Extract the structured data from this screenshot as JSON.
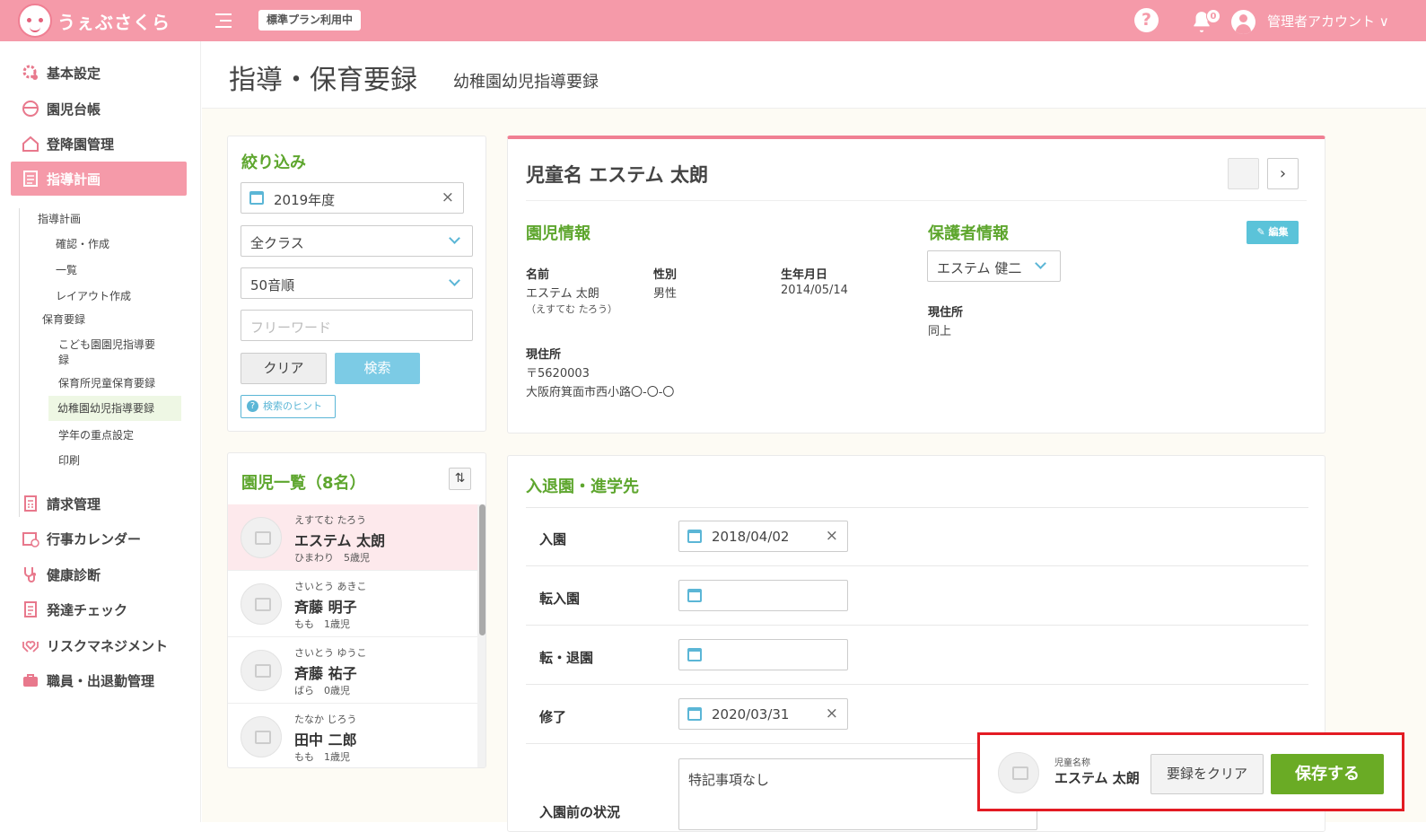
{
  "app": {
    "name": "うぇぶさくら",
    "plan_badge": "標準プラン利用中",
    "help": "?",
    "notification_count": "0",
    "account": "管理者アカウント ∨"
  },
  "sidebar": {
    "items": [
      {
        "label": "基本設定",
        "icon": "gear-icon"
      },
      {
        "label": "園児台帳",
        "icon": "child-icon"
      },
      {
        "label": "登降園管理",
        "icon": "house-icon"
      },
      {
        "label": "指導計画",
        "icon": "document-icon",
        "active": true
      },
      {
        "label": "請求管理",
        "icon": "calculator-icon"
      },
      {
        "label": "行事カレンダー",
        "icon": "calendar-icon"
      },
      {
        "label": "健康診断",
        "icon": "stethoscope-icon"
      },
      {
        "label": "発達チェック",
        "icon": "checklist-icon"
      },
      {
        "label": "リスクマネジメント",
        "icon": "hands-heart-icon"
      },
      {
        "label": "職員・出退勤管理",
        "icon": "briefcase-icon"
      }
    ],
    "sub": {
      "group1": "指導計画",
      "g1_items": [
        "確認・作成",
        "一覧",
        "レイアウト作成"
      ],
      "group2": "保育要録",
      "g2_items": [
        "こども園園児指導要",
        "録",
        "保育所児童保育要録",
        "幼稚園幼児指導要録",
        "学年の重点設定",
        "印刷"
      ]
    }
  },
  "header": {
    "title": "指導・保育要録",
    "subtitle": "幼稚園幼児指導要録"
  },
  "filter": {
    "title": "絞り込み",
    "year": "2019年度",
    "class": "全クラス",
    "order": "50音順",
    "keyword_placeholder": "フリーワード",
    "clear": "クリア",
    "search": "検索",
    "hint": "検索のヒント"
  },
  "list": {
    "title": "園児一覧（8名）",
    "children": [
      {
        "kana": "えすてむ たろう",
        "name": "エステム 太朗",
        "info": "ひまわり　5歳児"
      },
      {
        "kana": "さいとう あきこ",
        "name": "斉藤 明子",
        "info": "もも　1歳児"
      },
      {
        "kana": "さいとう ゆうこ",
        "name": "斉藤 祐子",
        "info": "ばら　0歳児"
      },
      {
        "kana": "たなか じろう",
        "name": "田中 二郎",
        "info": "もも　1歳児"
      }
    ]
  },
  "detail": {
    "child_title": "児童名 エステム 太朗",
    "child_section": "園児情報",
    "name_label": "名前",
    "name": "エステム 太朗",
    "name_kana": "（えすてむ たろう）",
    "gender_label": "性別",
    "gender": "男性",
    "birth_label": "生年月日",
    "birth": "2014/05/14",
    "address_label": "現住所",
    "postal": "〒5620003",
    "address": "大阪府箕面市西小路〇-〇-〇",
    "guardian_section": "保護者情報",
    "edit": "編集",
    "guardian": "エステム 健二",
    "guardian_address_label": "現住所",
    "guardian_address": "同上"
  },
  "enroll": {
    "title": "入退園・進学先",
    "rows": [
      {
        "label": "入園",
        "value": "2018/04/02"
      },
      {
        "label": "転入園",
        "value": ""
      },
      {
        "label": "転・退園",
        "value": ""
      },
      {
        "label": "修了",
        "value": "2020/03/31"
      }
    ],
    "pre_label": "入園前の状況",
    "note": "特記事項なし"
  },
  "footer": {
    "child_label": "児童名称",
    "child_name": "エステム 太朗",
    "clear": "要録をクリア",
    "save": "保存する"
  }
}
